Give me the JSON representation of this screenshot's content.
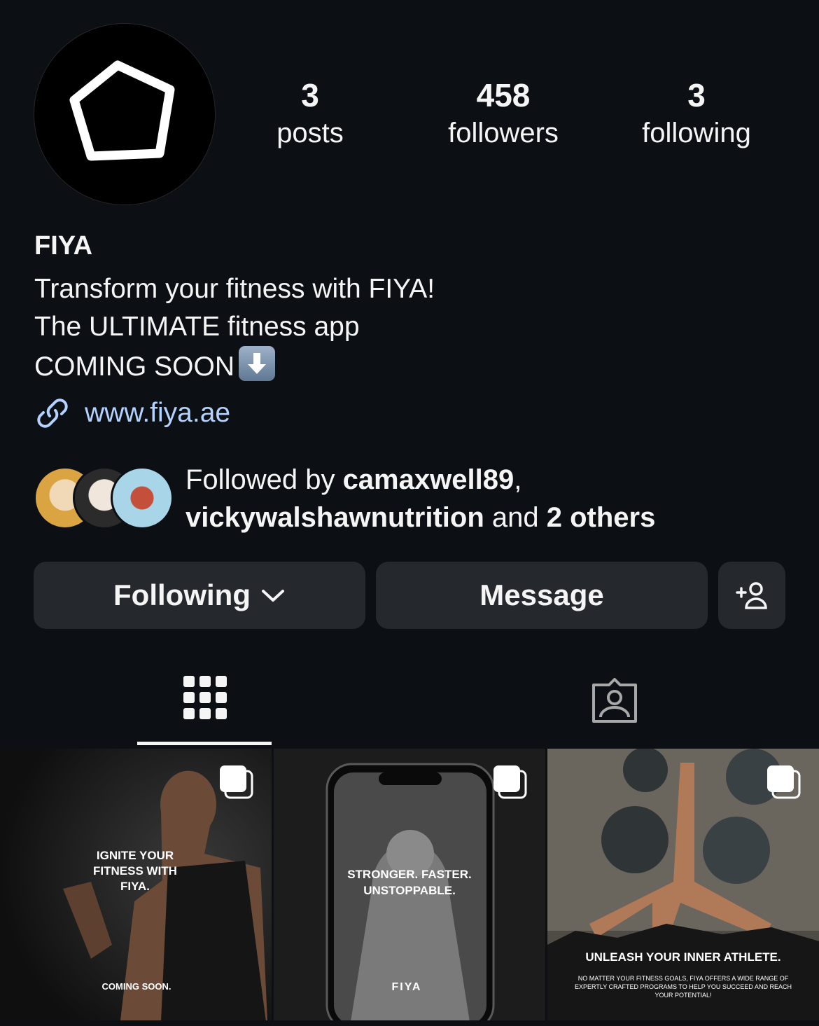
{
  "profile": {
    "name": "FIYA",
    "stats": [
      {
        "value": "3",
        "label": "posts"
      },
      {
        "value": "458",
        "label": "followers"
      },
      {
        "value": "3",
        "label": "following"
      }
    ],
    "bio_lines": [
      "Transform your fitness with FIYA!",
      "The ULTIMATE fitness app",
      "COMING SOON"
    ],
    "link": "www.fiya.ae",
    "followed_by": {
      "prefix": "Followed by ",
      "user1": "camaxwell89",
      "sep": ",",
      "user2": "vickywalshawnutrition",
      "and": " and ",
      "others": "2 others"
    }
  },
  "buttons": {
    "following": "Following",
    "message": "Message"
  },
  "posts": [
    {
      "headline": [
        "IGNITE YOUR",
        "FITNESS WITH",
        "FIYA."
      ],
      "footer": "COMING SOON."
    },
    {
      "headline": [
        "STRONGER. FASTER.",
        "UNSTOPPABLE."
      ],
      "footer": "FIYA"
    },
    {
      "headline": [
        "UNLEASH YOUR INNER ATHLETE."
      ],
      "footer": "NO MATTER YOUR FITNESS GOALS, FIYA OFFERS A WIDE RANGE OF EXPERTLY CRAFTED PROGRAMS TO HELP YOU SUCCEED AND REACH YOUR POTENTIAL!"
    }
  ],
  "colors": {
    "background": "#0c1014",
    "button": "#25292e",
    "link": "#b3d2ff"
  }
}
